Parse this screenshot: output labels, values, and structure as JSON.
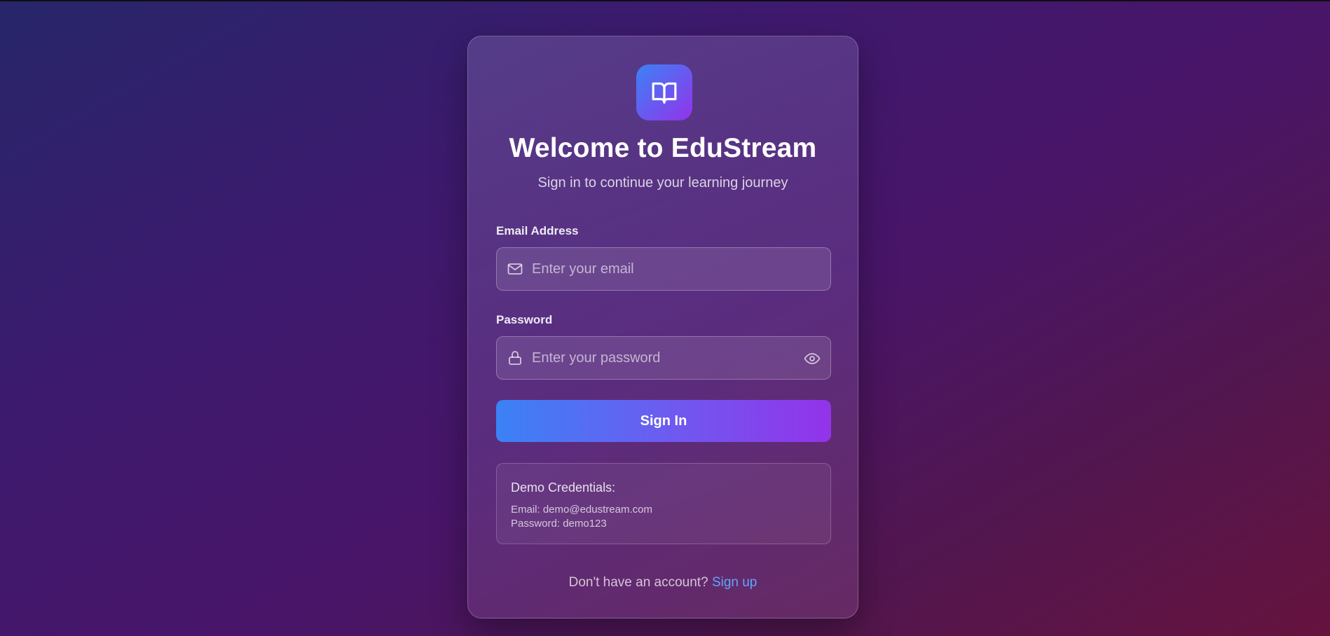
{
  "app": {
    "title": "Welcome to EduStream",
    "subtitle": "Sign in to continue your learning journey",
    "logo_icon": "open-book-icon"
  },
  "form": {
    "email_label": "Email Address",
    "email_placeholder": "Enter your email",
    "email_value": "",
    "email_icon": "mail-icon",
    "password_label": "Password",
    "password_placeholder": "Enter your password",
    "password_value": "",
    "password_icon": "lock-icon",
    "password_toggle_icon": "eye-icon",
    "submit_label": "Sign In"
  },
  "demo": {
    "title": "Demo Credentials:",
    "email_line": "Email: demo@edustream.com",
    "password_line": "Password: demo123"
  },
  "footer": {
    "prompt": "Don't have an account? ",
    "link_label": "Sign up"
  },
  "colors": {
    "accent_start": "#3b82f6",
    "accent_end": "#9333ea",
    "link": "#60a5fa"
  }
}
